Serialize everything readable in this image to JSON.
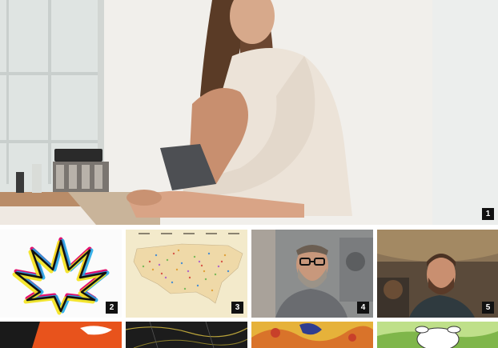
{
  "gallery": {
    "hero": {
      "badge": "1"
    },
    "row1": [
      {
        "badge": "2"
      },
      {
        "badge": "3"
      },
      {
        "badge": "4"
      },
      {
        "badge": "5"
      }
    ]
  }
}
